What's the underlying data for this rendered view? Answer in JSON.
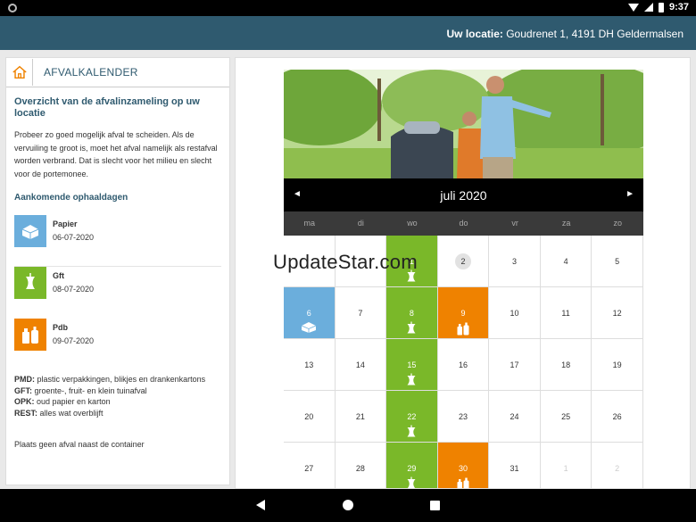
{
  "statusbar": {
    "time": "9:37"
  },
  "appbar": {
    "location_label": "Uw locatie:",
    "location_value": "Goudrenet 1, 4191 DH Geldermalsen"
  },
  "sidebar": {
    "title": "AFVALKALENDER",
    "heading": "Overzicht van de afvalinzameling op uw locatie",
    "intro": "Probeer zo goed mogelijk afval te scheiden. Als de vervuiling te groot is, moet het afval namelijk als restafval worden verbrand. Dat is slecht voor het milieu en slecht voor de portemonee.",
    "upcoming_title": "Aankomende ophaaldagen",
    "pickups": [
      {
        "type": "Papier",
        "date": "06-07-2020",
        "color": "#6baedc",
        "icon": "paper-icon"
      },
      {
        "type": "Gft",
        "date": "08-07-2020",
        "color": "#7ab829",
        "icon": "apple-core-icon"
      },
      {
        "type": "Pdb",
        "date": "09-07-2020",
        "color": "#ef8200",
        "icon": "bottles-icon"
      }
    ],
    "legend": [
      {
        "key": "PMD:",
        "text": "plastic verpakkingen, blikjes en drankenkartons"
      },
      {
        "key": "GFT:",
        "text": "groente-, fruit- en klein tuinafval"
      },
      {
        "key": "OPK:",
        "text": "oud papier en karton"
      },
      {
        "key": "REST:",
        "text": "alles wat overblijft"
      }
    ],
    "note": "Plaats geen afval naast de container"
  },
  "calendar": {
    "month": "juli 2020",
    "prev": "◄",
    "next": "►",
    "weekdays": [
      "ma",
      "di",
      "wo",
      "do",
      "vr",
      "za",
      "zo"
    ],
    "colors": {
      "green": "#7ab829",
      "orange": "#ef8200",
      "blue": "#6baedc"
    },
    "days": [
      {
        "n": "",
        "s": ""
      },
      {
        "n": "",
        "s": ""
      },
      {
        "n": "1",
        "s": "green",
        "icon": "apple-core-icon"
      },
      {
        "n": "2",
        "s": "today"
      },
      {
        "n": "3",
        "s": ""
      },
      {
        "n": "4",
        "s": ""
      },
      {
        "n": "5",
        "s": ""
      },
      {
        "n": "6",
        "s": "blue",
        "icon": "paper-icon"
      },
      {
        "n": "7",
        "s": ""
      },
      {
        "n": "8",
        "s": "green",
        "icon": "apple-core-icon"
      },
      {
        "n": "9",
        "s": "orange",
        "icon": "bottles-icon"
      },
      {
        "n": "10",
        "s": ""
      },
      {
        "n": "11",
        "s": ""
      },
      {
        "n": "12",
        "s": ""
      },
      {
        "n": "13",
        "s": ""
      },
      {
        "n": "14",
        "s": ""
      },
      {
        "n": "15",
        "s": "green",
        "icon": "apple-core-icon"
      },
      {
        "n": "16",
        "s": ""
      },
      {
        "n": "17",
        "s": ""
      },
      {
        "n": "18",
        "s": ""
      },
      {
        "n": "19",
        "s": ""
      },
      {
        "n": "20",
        "s": ""
      },
      {
        "n": "21",
        "s": ""
      },
      {
        "n": "22",
        "s": "green",
        "icon": "apple-core-icon"
      },
      {
        "n": "23",
        "s": ""
      },
      {
        "n": "24",
        "s": ""
      },
      {
        "n": "25",
        "s": ""
      },
      {
        "n": "26",
        "s": ""
      },
      {
        "n": "27",
        "s": ""
      },
      {
        "n": "28",
        "s": ""
      },
      {
        "n": "29",
        "s": "green",
        "icon": "apple-core-icon"
      },
      {
        "n": "30",
        "s": "orange",
        "icon": "bottles-icon"
      },
      {
        "n": "31",
        "s": ""
      },
      {
        "n": "1",
        "s": "muted"
      },
      {
        "n": "2",
        "s": "muted"
      }
    ]
  },
  "watermark": "UpdateStar.com"
}
